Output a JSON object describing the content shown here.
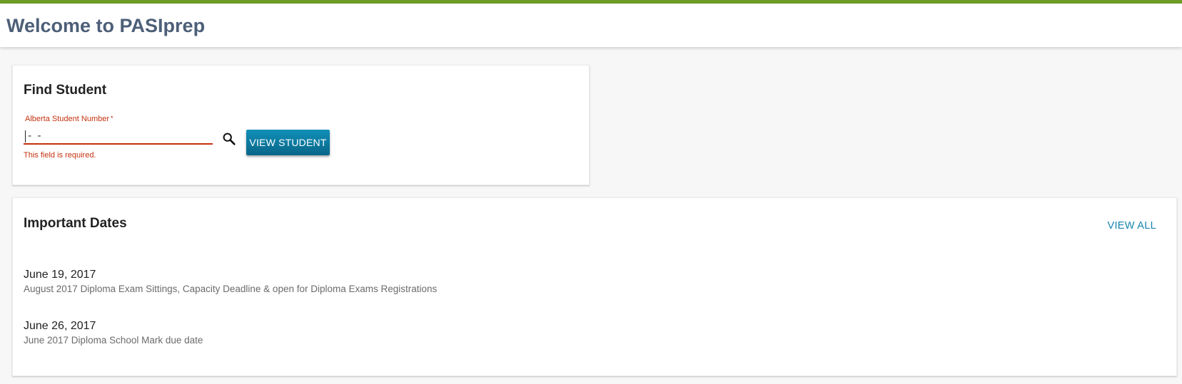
{
  "header": {
    "title": "Welcome to PASIprep"
  },
  "colors": {
    "accent_bar": "#6e9b25",
    "title": "#4d5f78",
    "error": "#c4310f",
    "button": "#0a6688",
    "link": "#1585ad"
  },
  "find_student": {
    "title": "Find Student",
    "field_label": "Alberta Student Number",
    "required_marker": "*",
    "mask_value": " -  -",
    "error_message": "This field is required.",
    "search_icon": "search-icon",
    "view_button_label": "VIEW STUDENT"
  },
  "important_dates": {
    "title": "Important Dates",
    "view_all_label": "VIEW ALL",
    "items": [
      {
        "date": "June 19, 2017",
        "description": "August 2017 Diploma Exam Sittings, Capacity Deadline & open for Diploma Exams Registrations"
      },
      {
        "date": "June 26, 2017",
        "description": "June 2017 Diploma School Mark due date"
      }
    ]
  }
}
